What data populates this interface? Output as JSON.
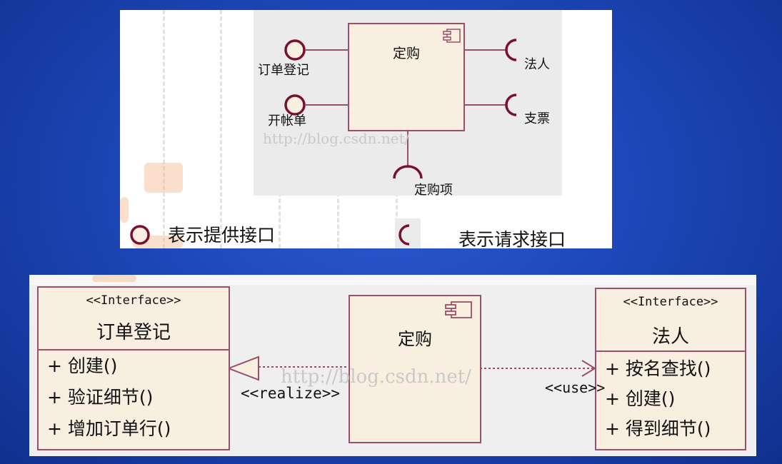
{
  "colors": {
    "border": "#9a4f6b",
    "fill": "#f8efe1",
    "background": "#1d47b8"
  },
  "top_diagram": {
    "component_name": "定购",
    "provided_interfaces": [
      "订单登记",
      "开帐单"
    ],
    "required_interfaces": [
      "法人",
      "支票",
      "定购项"
    ],
    "watermark": "http://blog.csdn.net/",
    "legend": {
      "provided_label": "表示提供接口",
      "required_label": "表示请求接口"
    }
  },
  "bottom_diagram": {
    "left_interface": {
      "stereotype": "<<Interface>>",
      "name": "订单登记",
      "operations": [
        "+ 创建()",
        "+ 验证细节()",
        "+ 增加订单行()"
      ]
    },
    "component_name": "定购",
    "right_interface": {
      "stereotype": "<<Interface>>",
      "name": "法人",
      "operations": [
        "+ 按名查找()",
        "+ 创建()",
        "+ 得到细节()"
      ]
    },
    "realize_label": "<<realize>>",
    "use_label": "<<use>>",
    "watermark": "http://blog.csdn.net/"
  }
}
